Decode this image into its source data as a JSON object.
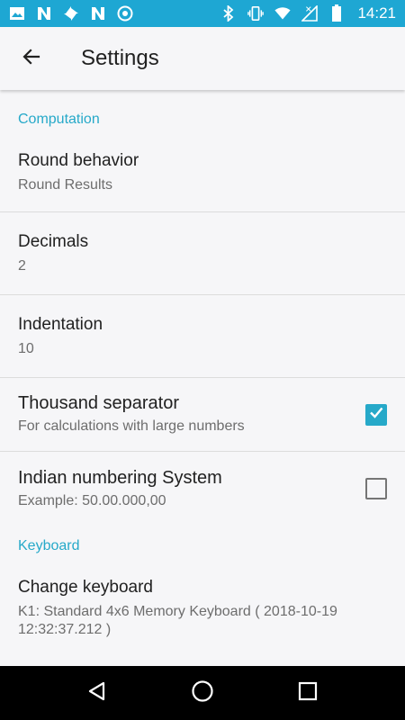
{
  "status_bar": {
    "time": "14:21",
    "left_icons": [
      "image-icon",
      "n-icon",
      "pinwheel-icon",
      "n-icon",
      "vpn-icon"
    ],
    "right_icons": [
      "bluetooth-icon",
      "vibrate-icon",
      "wifi-icon",
      "no-signal-icon",
      "battery-icon"
    ],
    "background": "#1ea7d3"
  },
  "toolbar": {
    "title": "Settings"
  },
  "sections": {
    "computation": {
      "label": "Computation",
      "round_behavior": {
        "title": "Round behavior",
        "summary": "Round Results"
      },
      "decimals": {
        "title": "Decimals",
        "summary": "2"
      },
      "indentation": {
        "title": "Indentation",
        "summary": "10"
      },
      "thousand_separator": {
        "title": "Thousand separator",
        "summary": "For calculations with large numbers",
        "checked": true
      },
      "indian_numbering": {
        "title": "Indian numbering System",
        "summary": "Example: 50.00.000,00",
        "checked": false
      }
    },
    "keyboard": {
      "label": "Keyboard",
      "change_keyboard": {
        "title": "Change keyboard",
        "summary": "K1: Standard 4x6 Memory Keyboard ( 2018-10-19 12:32:37.212 )"
      }
    }
  },
  "colors": {
    "accent": "#26a9c9",
    "text_primary": "#212121",
    "text_secondary": "#6d6d6d",
    "background": "#f6f6f8"
  },
  "nav_bar": {
    "buttons": [
      "back-triangle-icon",
      "home-circle-icon",
      "recents-square-icon"
    ]
  }
}
